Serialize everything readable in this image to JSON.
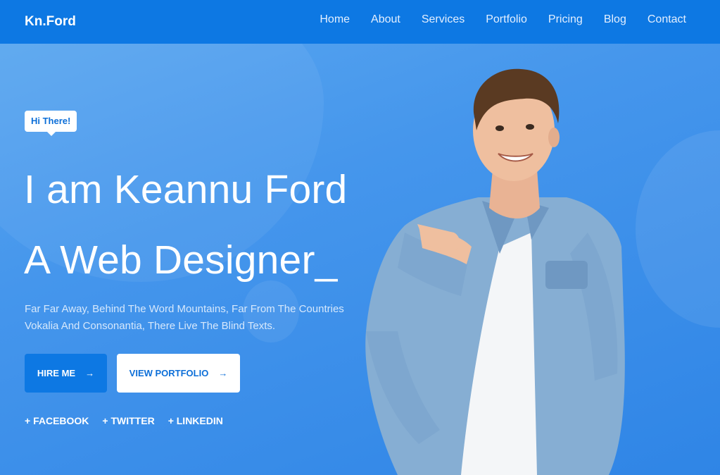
{
  "brand": "Kn.Ford",
  "nav": [
    "Home",
    "About",
    "Services",
    "Portfolio",
    "Pricing",
    "Blog",
    "Contact"
  ],
  "hero": {
    "tag": "Hi There!",
    "line1": "I am Keannu Ford",
    "line2": "A Web Designer_",
    "description": "Far Far Away, Behind The Word Mountains, Far From The Countries Vokalia And Consonantia, There Live The Blind Texts.",
    "hire_label": "HIRE ME",
    "portfolio_label": "VIEW PORTFOLIO",
    "arrow": "→"
  },
  "socials": [
    "+ FACEBOOK",
    "+ TWITTER",
    "+ LINKEDIN"
  ],
  "colors": {
    "nav": "#0d78e3",
    "accent": "#0d6fd8",
    "bg": "#4596ec"
  },
  "icons": {
    "arrow": "arrow-right-icon"
  }
}
